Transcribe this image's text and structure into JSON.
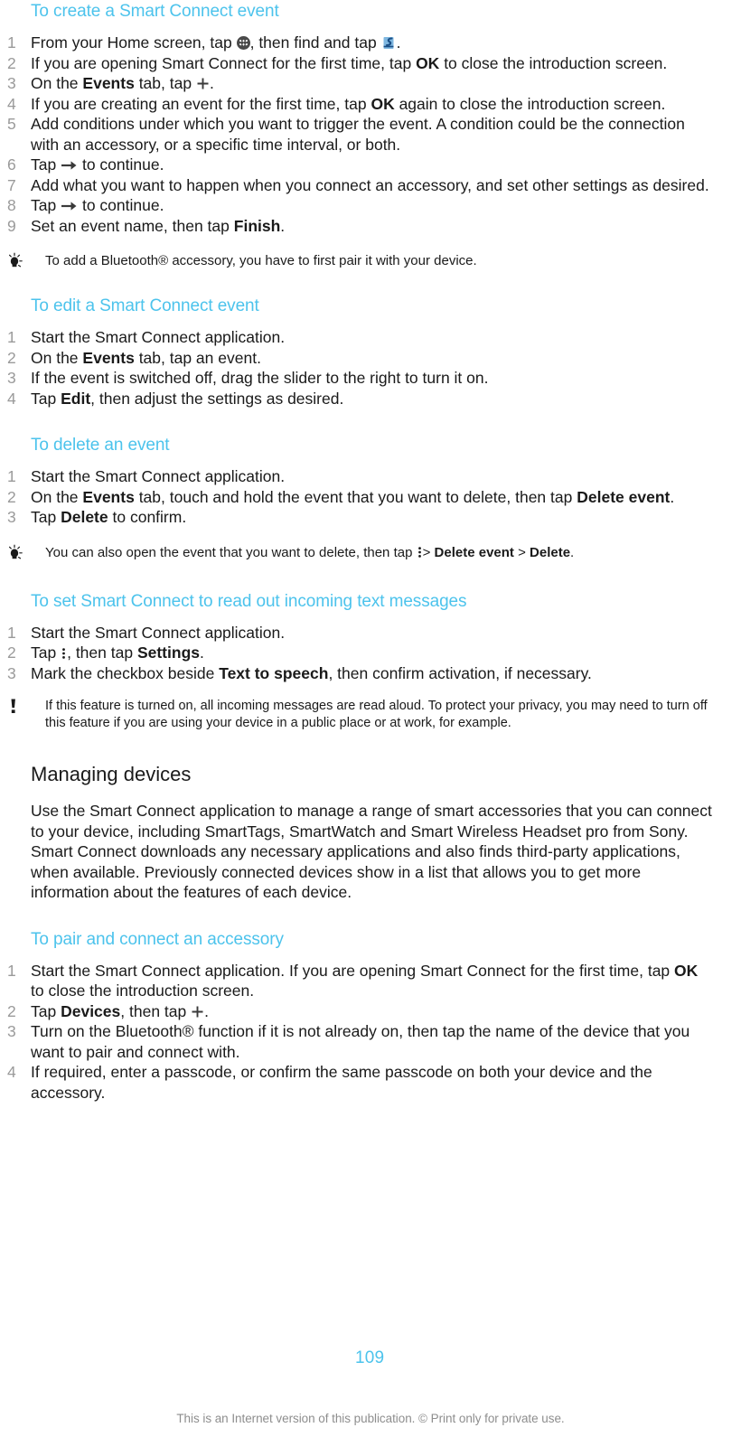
{
  "document": {
    "page_number": "109",
    "footer_note": "This is an Internet version of this publication. © Print only for private use.",
    "accent_color": "#4cc3ec",
    "text_color": "#1a1a1a",
    "step_number_color": "#9a9a9a"
  },
  "sections": {
    "create_event": {
      "heading": "To create a Smart Connect event",
      "steps": {
        "s1_a": "From your Home screen, tap",
        "s1_b": ", then find and tap",
        "s1_c": ".",
        "s2_a": "If you are opening Smart Connect for the first time, tap",
        "s2_bold": "OK",
        "s2_b": "to close the introduction screen.",
        "s3_a": "On the",
        "s3_bold": "Events",
        "s3_b": "tab, tap",
        "s3_c": ".",
        "s4_a": "If you are creating an event for the first time, tap",
        "s4_bold": "OK",
        "s4_b": "again to close the introduction screen.",
        "s5": "Add conditions under which you want to trigger the event. A condition could be the connection with an accessory, or a specific time interval, or both.",
        "s6_a": "Tap",
        "s6_b": "to continue.",
        "s7": "Add what you want to happen when you connect an accessory, and set other settings as desired.",
        "s8_a": "Tap",
        "s8_b": "to continue.",
        "s9_a": "Set an event name, then tap",
        "s9_bold": "Finish",
        "s9_b": "."
      },
      "tip": "To add a Bluetooth® accessory, you have to first pair it with your device."
    },
    "edit_event": {
      "heading": "To edit a Smart Connect event",
      "steps": {
        "s1": "Start the Smart Connect application.",
        "s2_a": "On the",
        "s2_bold": "Events",
        "s2_b": "tab, tap an event.",
        "s3": "If the event is switched off, drag the slider to the right to turn it on.",
        "s4_a": "Tap",
        "s4_bold": "Edit",
        "s4_b": ", then adjust the settings as desired."
      }
    },
    "delete_event": {
      "heading": "To delete an event",
      "steps": {
        "s1": "Start the Smart Connect application.",
        "s2_a": "On the",
        "s2_bold": "Events",
        "s2_b": "tab, touch and hold the event that you want to delete, then tap",
        "s2_bold2": "Delete event",
        "s2_c": ".",
        "s3_a": "Tap",
        "s3_bold": "Delete",
        "s3_b": "to confirm."
      },
      "tip": {
        "a": "You can also open the event that you want to delete, then tap",
        "sep1": ">",
        "bold1": "Delete event",
        "sep2": ">",
        "bold2": "Delete",
        "b": "."
      }
    },
    "read_out_sms": {
      "heading": "To set Smart Connect to read out incoming text messages",
      "steps": {
        "s1": "Start the Smart Connect application.",
        "s2_a": "Tap",
        "s2_b": ", then tap",
        "s2_bold": "Settings",
        "s2_c": ".",
        "s3_a": "Mark the checkbox beside",
        "s3_bold": "Text to speech",
        "s3_b": ", then confirm activation, if necessary."
      },
      "warning": "If this feature is turned on, all incoming messages are read aloud. To protect your privacy, you may need to turn off this feature if you are using your device in a public place or at work, for example."
    },
    "managing_devices": {
      "heading": "Managing devices",
      "body": "Use the Smart Connect application to manage a range of smart accessories that you can connect to your device, including SmartTags, SmartWatch and Smart Wireless Headset pro from Sony. Smart Connect downloads any necessary applications and also finds third-party applications, when available. Previously connected devices show in a list that allows you to get more information about the features of each device."
    },
    "pair_accessory": {
      "heading": "To pair and connect an accessory",
      "steps": {
        "s1_a": "Start the Smart Connect application. If you are opening Smart Connect for the first time, tap",
        "s1_bold": "OK",
        "s1_b": "to close the introduction screen.",
        "s2_a": "Tap",
        "s2_bold": "Devices",
        "s2_b": ", then tap",
        "s2_c": ".",
        "s3": "Turn on the Bluetooth® function if it is not already on, then tap the name of the device that you want to pair and connect with.",
        "s4": "If required, enter a passcode, or confirm the same passcode on both your device and the accessory."
      }
    }
  },
  "icons": {
    "apps": "apps-grid-icon",
    "smart_connect": "smart-connect-icon",
    "arrow_right": "arrow-right-icon",
    "plus": "plus-icon",
    "kebab_menu": "overflow-menu-icon",
    "tip": "lightbulb-tip-icon",
    "warning": "exclamation-warning-icon"
  }
}
